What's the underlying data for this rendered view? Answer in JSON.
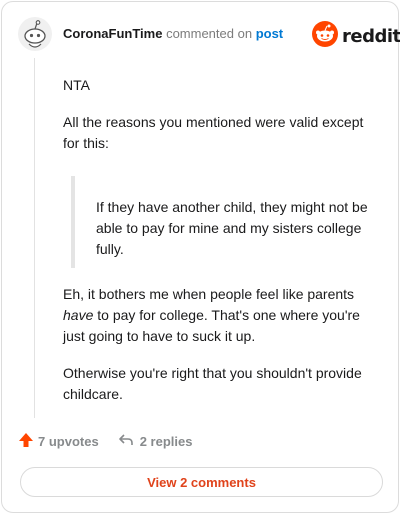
{
  "comment": {
    "username": "CoronaFunTime",
    "action_text": "commented on",
    "target_link": "post",
    "paragraph_1": "NTA",
    "paragraph_2": "All the reasons you mentioned were valid except for this:",
    "quote": "If they have another child, they might not be able to pay for mine and my sisters college fully.",
    "paragraph_3_before": "Eh, it bothers me when people feel like parents ",
    "paragraph_3_emphasis": "have",
    "paragraph_3_after": " to pay for college. That's one where you're just going to have to suck it up.",
    "paragraph_4": "Otherwise you're right that you shouldn't provide childcare."
  },
  "brand": {
    "logo_text": "reddit",
    "accent_color": "#ff4500"
  },
  "footer": {
    "upvotes": "7 upvotes",
    "replies": "2 replies",
    "view_button": "View 2 comments"
  },
  "icons": {
    "avatar": "snoo-avatar-icon",
    "logo": "reddit-logo-icon",
    "upvote": "upvote-arrow-icon",
    "reply": "reply-arrow-icon"
  }
}
